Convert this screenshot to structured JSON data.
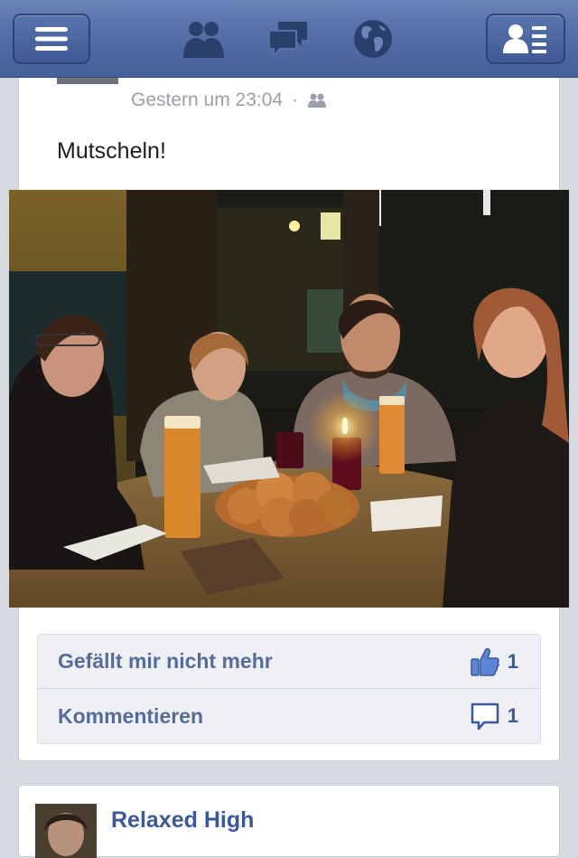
{
  "topbar": {
    "menu_icon": "menu-icon",
    "friends_icon": "friend-requests-icon",
    "messages_icon": "messages-icon",
    "notifications_icon": "globe-icon",
    "contacts_icon": "contacts-list-icon"
  },
  "post": {
    "timestamp": "Gestern um 23:04",
    "separator": "·",
    "audience_icon": "friends-audience-icon",
    "text": "Mutscheln!",
    "actions": {
      "like_label": "Gefällt mir nicht mehr",
      "like_count": "1",
      "comment_label": "Kommentieren",
      "comment_count": "1"
    },
    "colors": {
      "accent": "#3b5998",
      "link": "#566c98",
      "meta": "#9a9fa8"
    }
  },
  "next_post": {
    "author": "Relaxed High"
  }
}
